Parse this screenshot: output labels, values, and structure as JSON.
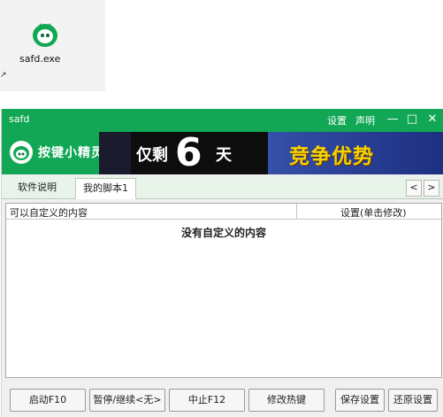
{
  "desktop": {
    "file_name": "safd.exe",
    "arrow": "↗"
  },
  "window": {
    "title": "safd",
    "links": [
      "设置",
      "声明"
    ],
    "controls": {
      "minimize": "—",
      "maximize": "□",
      "close": "✕"
    }
  },
  "brand": {
    "name": "按键小精灵"
  },
  "ad": {
    "part1": "仅剩",
    "big_number": "6",
    "part2": "天",
    "slogan": "竞争优势"
  },
  "tabs": [
    {
      "label": "软件说明",
      "active": false
    },
    {
      "label": "我的脚本1",
      "active": true
    }
  ],
  "tab_nav": {
    "prev": "<",
    "next": ">"
  },
  "table": {
    "columns": [
      "可以自定义的内容",
      "设置(单击修改)"
    ],
    "empty_message": "没有自定义的内容"
  },
  "buttons": [
    "启动F10",
    "暂停/继续<无>",
    "中止F12",
    "修改热键",
    "保存设置",
    "还原设置"
  ],
  "colors": {
    "brand_green": "#11a754",
    "tab_bg": "#e8f3ea"
  }
}
